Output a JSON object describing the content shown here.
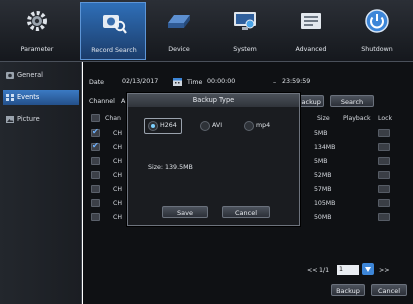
{
  "top_nav": [
    {
      "label": "Parameter",
      "icon": "gear-icon"
    },
    {
      "label": "Record Search",
      "icon": "camera-search-icon",
      "active": true
    },
    {
      "label": "Device",
      "icon": "hard-disk-icon"
    },
    {
      "label": "System",
      "icon": "monitor-icon"
    },
    {
      "label": "Advanced",
      "icon": "advanced-icon"
    },
    {
      "label": "Shutdown",
      "icon": "power-icon"
    }
  ],
  "sidebar": [
    {
      "label": "General",
      "icon": "record-icon"
    },
    {
      "label": "Events",
      "icon": "events-icon",
      "active": true
    },
    {
      "label": "Picture",
      "icon": "picture-icon"
    }
  ],
  "search": {
    "date_label": "Date",
    "date_value": "02/13/2017",
    "time_label": "Time",
    "time_from": "00:00:00",
    "time_sep": "–",
    "time_to": "23:59:59",
    "channel_label": "Channel",
    "channel_visible": "A",
    "backup_label": "Backup",
    "search_label": "Search"
  },
  "table": {
    "headers": [
      "Chan",
      "Size",
      "Playback",
      "Lock"
    ],
    "rows": [
      {
        "channel": "CH",
        "checked": true,
        "size": "5MB"
      },
      {
        "channel": "CH",
        "checked": true,
        "size": "134MB"
      },
      {
        "channel": "CH",
        "checked": false,
        "size": "5MB"
      },
      {
        "channel": "CH",
        "checked": false,
        "size": "52MB"
      },
      {
        "channel": "CH",
        "checked": false,
        "size": "57MB"
      },
      {
        "channel": "CH",
        "checked": false,
        "size": "105MB"
      },
      {
        "channel": "CH",
        "checked": false,
        "size": "50MB"
      }
    ]
  },
  "dialog": {
    "title": "Backup Type",
    "options": [
      {
        "label": "H264",
        "selected": true
      },
      {
        "label": "AVI",
        "selected": false
      },
      {
        "label": "mp4",
        "selected": false
      }
    ],
    "size_text": "Size: 139.5MB",
    "save_label": "Save",
    "cancel_label": "Cancel"
  },
  "pager": {
    "prev": "<<",
    "page": "1/1",
    "input": "1",
    "next": ">>"
  },
  "footer": {
    "backup_label": "Backup",
    "cancel_label": "Cancel"
  },
  "colors": {
    "accent": "#2f6fb8",
    "check": "#6fb3ff",
    "radio_on": "#7cd0ff"
  }
}
